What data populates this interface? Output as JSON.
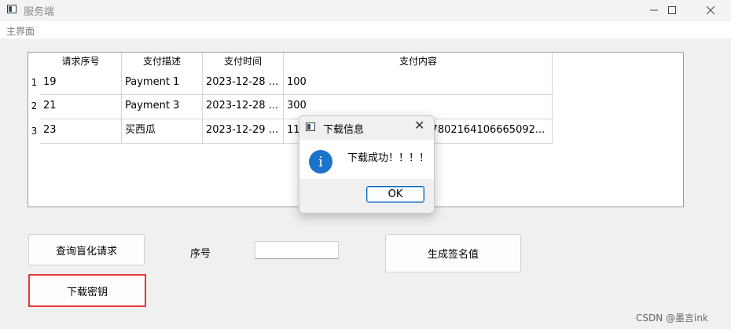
{
  "window": {
    "title": "服务端"
  },
  "menu": {
    "main": "主界面"
  },
  "table": {
    "headers": [
      "请求序号",
      "支付描述",
      "支付时间",
      "支付内容"
    ],
    "rows": [
      {
        "index": "1",
        "cells": [
          "19",
          "Payment 1",
          "2023-12-28 ...",
          "100"
        ]
      },
      {
        "index": "2",
        "cells": [
          "21",
          "Payment 3",
          "2023-12-28 ...",
          "300"
        ]
      },
      {
        "index": "3",
        "cells": [
          "23",
          "买西瓜",
          "2023-12-29 ...",
          "11",
          "417802164106665092..."
        ]
      }
    ]
  },
  "controls": {
    "query_button": "查询盲化请求",
    "seq_label": "序号",
    "seq_value": "",
    "generate_button": "生成签名值",
    "download_button": "下载密钥"
  },
  "dialog": {
    "title": "下载信息",
    "message": "下载成功！！！！",
    "ok": "OK"
  },
  "watermark": "CSDN @墨言ink",
  "colors": {
    "highlight_border": "#e53935",
    "info_icon": "#1b74c9",
    "accent": "#0067c0"
  }
}
